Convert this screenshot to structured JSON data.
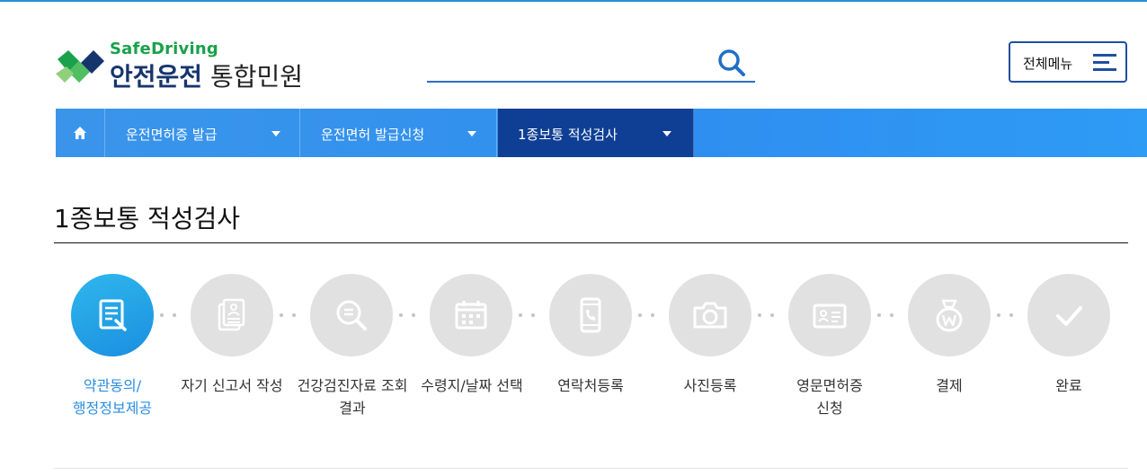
{
  "header": {
    "logo_sub": "SafeDriving",
    "logo_main_bold": "안전운전",
    "logo_main_light": " 통합민원",
    "search_placeholder": "",
    "all_menu_label": "전체메뉴"
  },
  "nav": {
    "items": [
      {
        "label": "운전면허증 발급"
      },
      {
        "label": "운전면허 발급신청"
      },
      {
        "label": "1종보통 적성검사"
      }
    ]
  },
  "page": {
    "title": "1종보통 적성검사"
  },
  "steps": [
    {
      "label": "약관동의/\n행정정보제공",
      "icon": "document-edit-icon",
      "active": true
    },
    {
      "label": "자기 신고서 작성",
      "icon": "self-report-icon",
      "active": false
    },
    {
      "label": "건강검진자료 조회\n결과",
      "icon": "search-document-icon",
      "active": false
    },
    {
      "label": "수령지/날짜 선택",
      "icon": "calendar-icon",
      "active": false
    },
    {
      "label": "연락처등록",
      "icon": "phone-icon",
      "active": false
    },
    {
      "label": "사진등록",
      "icon": "camera-icon",
      "active": false
    },
    {
      "label": "영문면허증\n신청",
      "icon": "id-card-icon",
      "active": false
    },
    {
      "label": "결제",
      "icon": "money-bag-icon",
      "active": false
    },
    {
      "label": "완료",
      "icon": "check-icon",
      "active": false
    }
  ],
  "colors": {
    "nav_bg": "#2f8ff0",
    "nav_active": "#0e3f94",
    "step_active": "#1a8fe0",
    "step_inactive": "#e1e1e1",
    "logo_green": "#1aa14b",
    "logo_navy": "#17356d"
  }
}
